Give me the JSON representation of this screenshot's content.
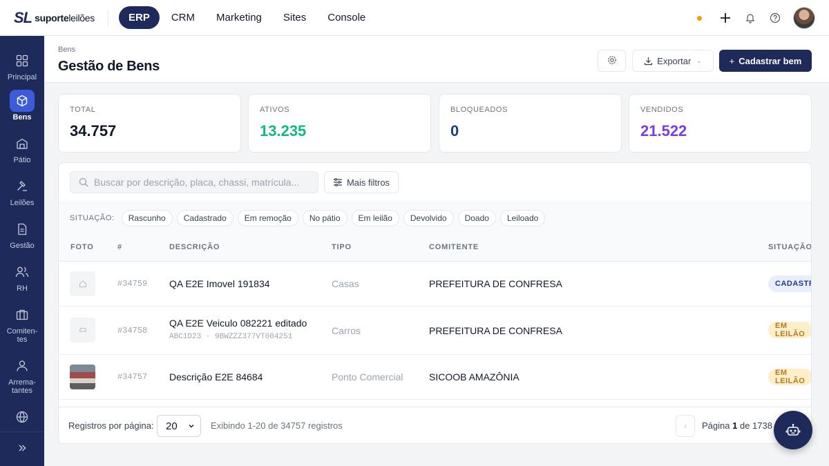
{
  "brand": {
    "logo_mark": "SL",
    "name_bold": "suporte",
    "name_rest": "leilões"
  },
  "top_nav": [
    {
      "label": "ERP",
      "active": true
    },
    {
      "label": "CRM",
      "active": false
    },
    {
      "label": "Marketing",
      "active": false
    },
    {
      "label": "Sites",
      "active": false
    },
    {
      "label": "Console",
      "active": false
    }
  ],
  "top_icons": [
    "status-dot",
    "plus-icon",
    "bell-icon",
    "help-icon",
    "avatar"
  ],
  "sidebar": {
    "items": [
      {
        "label": "Principal",
        "icon": "grid-icon",
        "active": false
      },
      {
        "label": "Bens",
        "icon": "box-icon",
        "active": true
      },
      {
        "label": "Pátio",
        "icon": "warehouse-icon",
        "active": false
      },
      {
        "label": "Leilões",
        "icon": "gavel-icon",
        "active": false
      },
      {
        "label": "Gestão",
        "icon": "document-icon",
        "active": false
      },
      {
        "label": "RH",
        "icon": "users-icon",
        "active": false
      },
      {
        "label": "Comiten-\ntes",
        "icon": "briefcase-icon",
        "active": false
      },
      {
        "label": "Arrema-\ntantes",
        "icon": "user-icon",
        "active": false
      },
      {
        "label": "",
        "icon": "globe-icon",
        "active": false
      }
    ],
    "expand_icon": "chevrons-right-icon"
  },
  "header": {
    "breadcrumb": "Bens",
    "title": "Gestão de Bens",
    "export_label": "Exportar",
    "primary_label": "Cadastrar bem"
  },
  "stats": [
    {
      "label": "TOTAL",
      "value": "34.757",
      "color": "#111827"
    },
    {
      "label": "ATIVOS",
      "value": "13.235",
      "color": "#10b981"
    },
    {
      "label": "BLOQUEADOS",
      "value": "0",
      "color": "#1e3a8a"
    },
    {
      "label": "VENDIDOS",
      "value": "21.522",
      "color": "#7c3aed"
    }
  ],
  "search": {
    "placeholder": "Buscar por descrição, placa, chassi, matrícula..."
  },
  "filters_label": "Mais filtros",
  "situacao": {
    "label": "SITUAÇÃO:",
    "chips": [
      "Rascunho",
      "Cadastrado",
      "Em remoção",
      "No pátio",
      "Em leilão",
      "Devolvido",
      "Doado",
      "Leiloado"
    ]
  },
  "table": {
    "columns": [
      "FOTO",
      "#",
      "DESCRIÇÃO",
      "TIPO",
      "COMITENTE",
      "SITUAÇÃO"
    ],
    "rows": [
      {
        "photo": "house-icon",
        "id": "#34759",
        "descricao": "QA E2E Imovel 191834",
        "sub": "",
        "tipo": "Casas",
        "comitente": "PREFEITURA DE CONFRESA",
        "situacao": "CADASTRADO"
      },
      {
        "photo": "car-icon",
        "id": "#34758",
        "descricao": "QA E2E Veiculo 082221 editado",
        "sub": "ABC1D23 · 9BWZZZ377VT004251",
        "tipo": "Carros",
        "comitente": "PREFEITURA DE CONFRESA",
        "situacao": "EM LEILÃO"
      },
      {
        "photo": "photo",
        "id": "#34757",
        "descricao": "Descrição E2E 84684",
        "sub": "",
        "tipo": "Ponto Comercial",
        "comitente": "SICOOB AMAZÔNIA",
        "situacao": "EM LEILÃO"
      }
    ]
  },
  "footer": {
    "per_page_label": "Registros por página:",
    "per_page_value": "20",
    "info": "Exibindo 1-20 de 34757 registros",
    "page_prefix": "Página",
    "page_current": "1",
    "page_suffix": "de 1738"
  },
  "fab_icon": "robot-icon"
}
